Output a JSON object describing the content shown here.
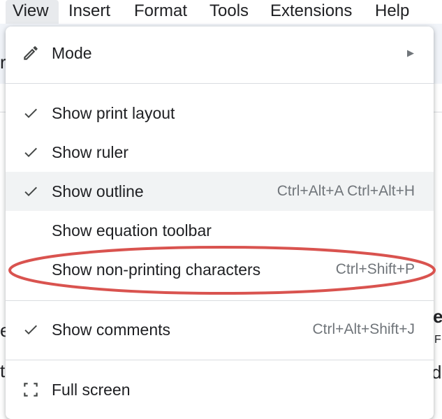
{
  "menubar": {
    "items": [
      {
        "label": "View",
        "active": true
      },
      {
        "label": "Insert"
      },
      {
        "label": "Format"
      },
      {
        "label": "Tools"
      },
      {
        "label": "Extensions"
      },
      {
        "label": "Help"
      }
    ]
  },
  "background_fragments": {
    "left_top": "r",
    "left_mid": "e",
    "left_low": "t",
    "right_mid": "e",
    "right_small": "F",
    "right_low": "d"
  },
  "view_menu": {
    "items": [
      {
        "label": "Mode",
        "icon": "pencil-icon",
        "submenu_indicator": "▶"
      },
      {
        "label": "Show print layout",
        "icon": "check-icon",
        "checked": true
      },
      {
        "label": "Show ruler",
        "icon": "check-icon",
        "checked": true
      },
      {
        "label": "Show outline",
        "icon": "check-icon",
        "checked": true,
        "shortcut": "Ctrl+Alt+A Ctrl+Alt+H",
        "highlighted": true
      },
      {
        "label": "Show equation toolbar",
        "checked": false
      },
      {
        "label": "Show non-printing characters",
        "checked": false,
        "shortcut": "Ctrl+Shift+P",
        "annotated": true
      },
      {
        "label": "Show comments",
        "icon": "check-icon",
        "checked": true,
        "shortcut": "Ctrl+Alt+Shift+J"
      },
      {
        "label": "Full screen",
        "icon": "fullscreen-icon"
      }
    ]
  },
  "colors": {
    "annotation": "#d9534f",
    "highlight": "#f1f3f4",
    "menubar_active": "#e8eaed",
    "shortcut_text": "#70757a"
  }
}
